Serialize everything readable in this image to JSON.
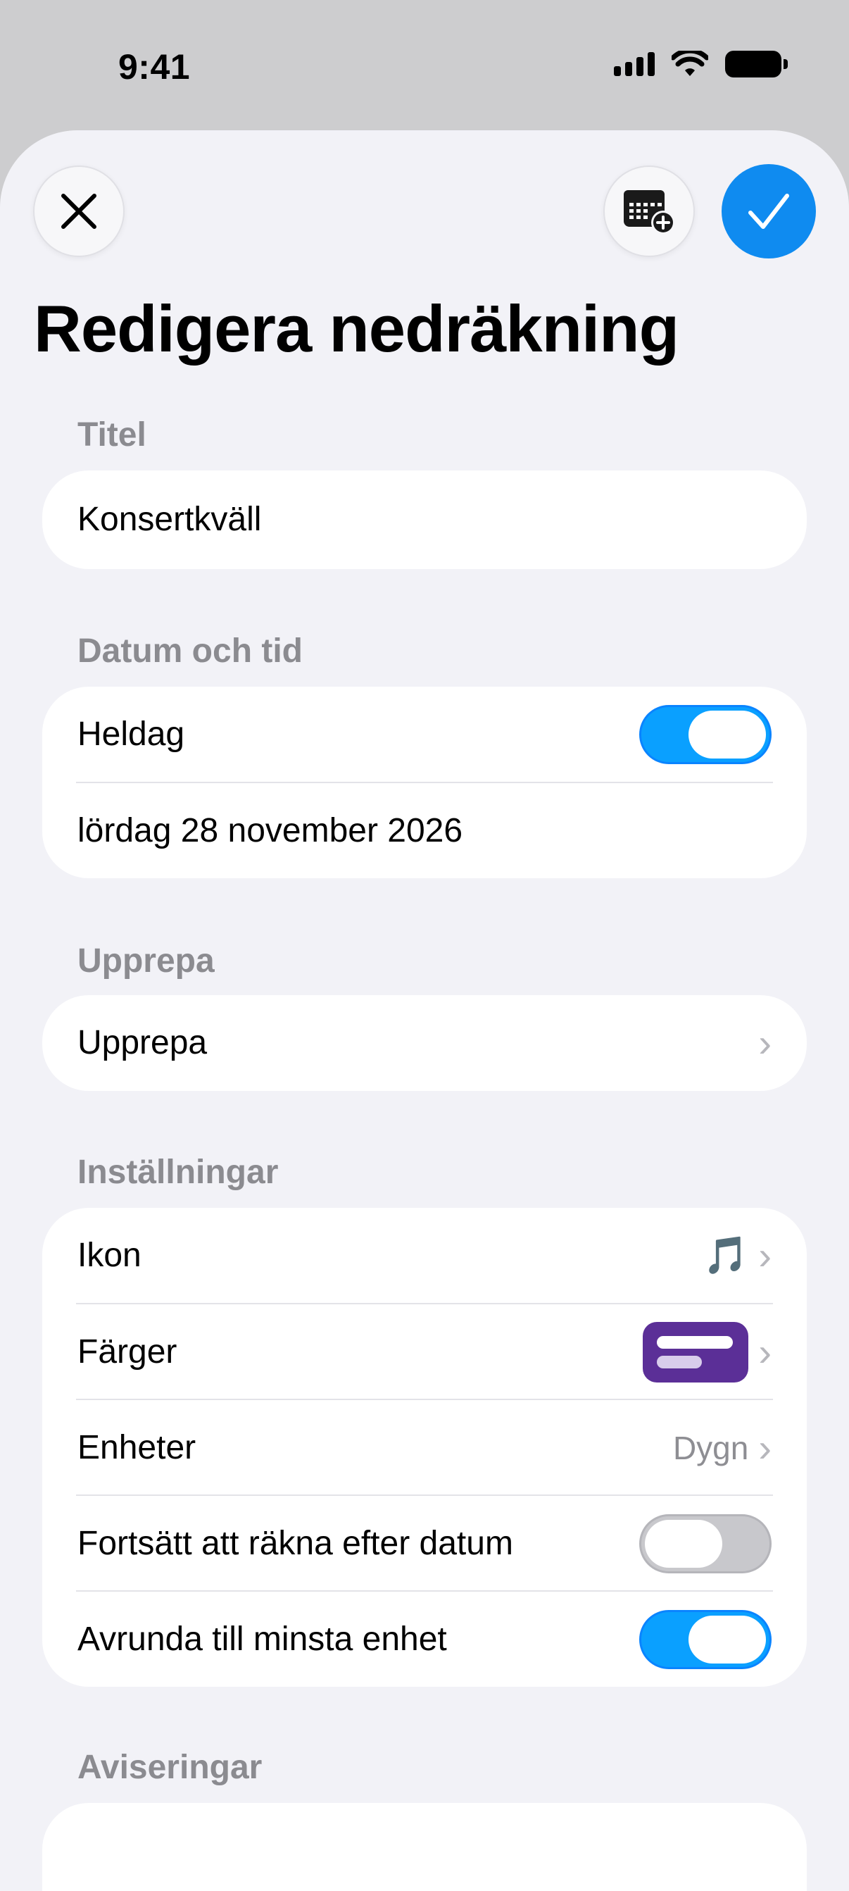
{
  "status": {
    "time": "9:41"
  },
  "header": {
    "title": "Redigera nedräkning"
  },
  "sections": {
    "title": {
      "label": "Titel",
      "value": "Konsertkväll"
    },
    "datetime": {
      "label": "Datum och tid",
      "allday_label": "Heldag",
      "allday_on": true,
      "date": "lördag 28 november 2026"
    },
    "repeat": {
      "label": "Upprepa",
      "row_label": "Upprepa"
    },
    "settings": {
      "label": "Inställningar",
      "icon_label": "Ikon",
      "icon_value": "🎵",
      "colors_label": "Färger",
      "colors_value": "#5b2f97",
      "units_label": "Enheter",
      "units_value": "Dygn",
      "continue_label": "Fortsätt att räkna efter datum",
      "continue_on": false,
      "round_label": "Avrunda till minsta enhet",
      "round_on": true
    },
    "notifications": {
      "label": "Aviseringar"
    }
  },
  "colors": {
    "accent": "#0a84ff",
    "done": "#0f8bf0"
  }
}
